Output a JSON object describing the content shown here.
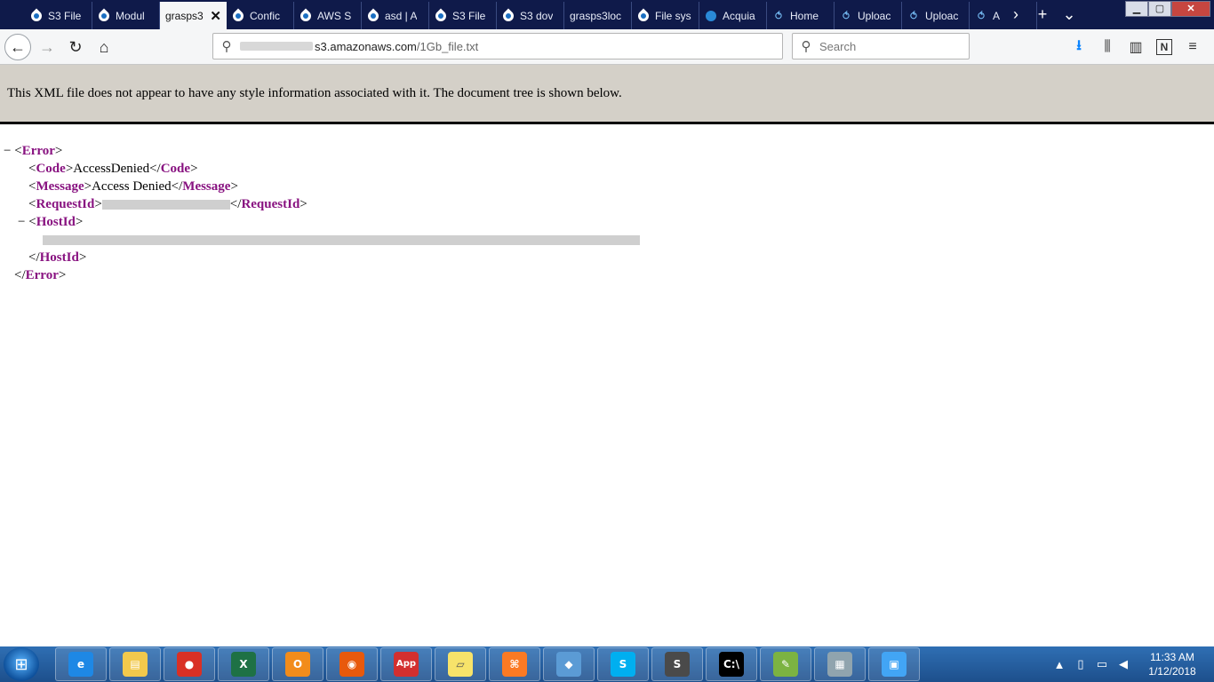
{
  "browser": {
    "tabs": [
      {
        "title": "S3 File",
        "icon": "drupal-icon"
      },
      {
        "title": "Modul",
        "icon": "drupal-icon"
      },
      {
        "title": "grasps3",
        "icon": "",
        "active": true
      },
      {
        "title": "Confic",
        "icon": "drupal-icon"
      },
      {
        "title": "AWS S",
        "icon": "drupal-icon"
      },
      {
        "title": "asd | A",
        "icon": "drupal-icon"
      },
      {
        "title": "S3 File",
        "icon": "drupal-icon"
      },
      {
        "title": "S3 dov",
        "icon": "drupal-icon"
      },
      {
        "title": "grasps3loc",
        "icon": ""
      },
      {
        "title": "File sys",
        "icon": "drupal-icon"
      },
      {
        "title": "Acquia",
        "icon": "acquia-dot-icon"
      },
      {
        "title": "Home",
        "icon": "hook-icon"
      },
      {
        "title": "Uploac",
        "icon": "hook-icon"
      },
      {
        "title": "Uploac",
        "icon": "hook-icon"
      },
      {
        "title": "A",
        "icon": "hook-icon"
      }
    ],
    "close_glyph": "✕",
    "controls": {
      "scroll": "›",
      "new_tab": "+",
      "list": "⌄"
    },
    "window": {
      "minimize": "▁",
      "maximize": "▢",
      "close": "✕"
    },
    "nav": {
      "back": "←",
      "forward": "→",
      "reload": "↻",
      "home": "⌂"
    },
    "url": {
      "host": "s3.amazonaws.com",
      "path": "/1Gb_file.txt",
      "icon": "search-icon"
    },
    "search": {
      "placeholder": "Search"
    },
    "right_icons": [
      "download-icon",
      "library-icon",
      "sidebar-icon",
      "extension-n-icon",
      "menu-icon"
    ],
    "right_glyphs": {
      "download": "⭳",
      "library": "⫼",
      "sidebar": "▥",
      "extension": "N",
      "menu": "≡"
    }
  },
  "xml_info": "This XML file does not appear to have any style information associated with it. The document tree is shown below.",
  "tree": {
    "toggle": "−",
    "error_tag": "Error",
    "code_tag": "Code",
    "code_value": "AccessDenied",
    "message_tag": "Message",
    "message_value": "Access Denied",
    "requestid_tag": "RequestId",
    "hostid_tag": "HostId"
  },
  "taskbar": {
    "apps": [
      "internet-explorer-icon",
      "file-explorer-icon",
      "chrome-icon",
      "excel-icon",
      "outlook-icon",
      "firefox-icon",
      "app-icon",
      "sticky-notes-icon",
      "xampp-icon",
      "git-icon",
      "skype-icon",
      "sublime-text-icon",
      "cmd-icon",
      "notepad-plus-icon",
      "calculator-icon",
      "network-icon"
    ],
    "app_label": "App",
    "time": "11:33 AM",
    "date": "1/12/2018"
  }
}
